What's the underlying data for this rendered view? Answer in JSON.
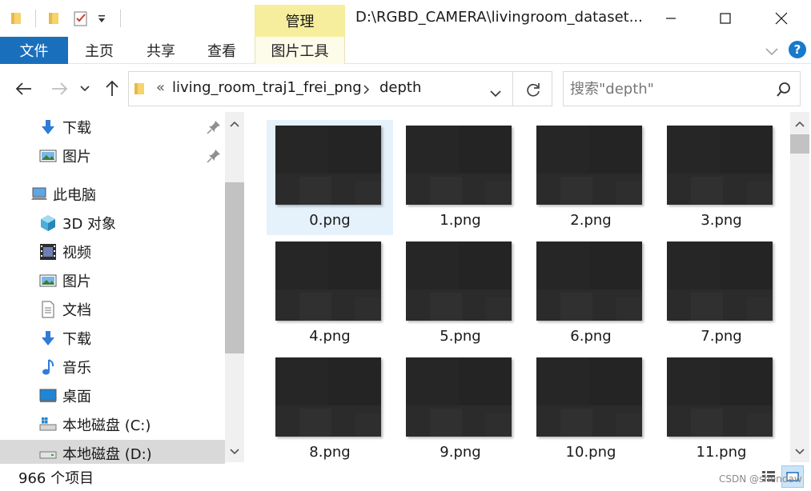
{
  "window": {
    "title": "D:\\RGBD_CAMERA\\livingroom_dataset...",
    "context_tab": "管理",
    "accent_color": "#1a6fbd",
    "context_tab_color": "#f6ee9c"
  },
  "ribbon": {
    "tabs": [
      "文件",
      "主页",
      "共享",
      "查看",
      "图片工具"
    ]
  },
  "address": {
    "overflow": "«",
    "parent": "living_room_traj1_frei_png",
    "current": "depth",
    "search_placeholder": "搜索\"depth\""
  },
  "nav": {
    "items": [
      {
        "label": "下载",
        "icon": "download-icon",
        "pinned": true
      },
      {
        "label": "图片",
        "icon": "pictures-icon",
        "pinned": true
      },
      {
        "label": "此电脑",
        "icon": "this-pc-icon"
      },
      {
        "label": "3D 对象",
        "icon": "3d-objects-icon"
      },
      {
        "label": "视频",
        "icon": "videos-icon"
      },
      {
        "label": "图片",
        "icon": "pictures-icon"
      },
      {
        "label": "文档",
        "icon": "documents-icon"
      },
      {
        "label": "下载",
        "icon": "download-icon"
      },
      {
        "label": "音乐",
        "icon": "music-icon"
      },
      {
        "label": "桌面",
        "icon": "desktop-icon"
      },
      {
        "label": "本地磁盘 (C:)",
        "icon": "drive-c-icon"
      },
      {
        "label": "本地磁盘 (D:)",
        "icon": "drive-d-icon",
        "selected": true
      }
    ]
  },
  "files": [
    {
      "name": "0.png",
      "selected": true
    },
    {
      "name": "1.png"
    },
    {
      "name": "2.png"
    },
    {
      "name": "3.png"
    },
    {
      "name": "4.png"
    },
    {
      "name": "5.png"
    },
    {
      "name": "6.png"
    },
    {
      "name": "7.png"
    },
    {
      "name": "8.png"
    },
    {
      "name": "9.png"
    },
    {
      "name": "10.png"
    },
    {
      "name": "11.png"
    }
  ],
  "status": {
    "item_count": "966 个项目"
  },
  "watermark": "CSDN @shendaw"
}
